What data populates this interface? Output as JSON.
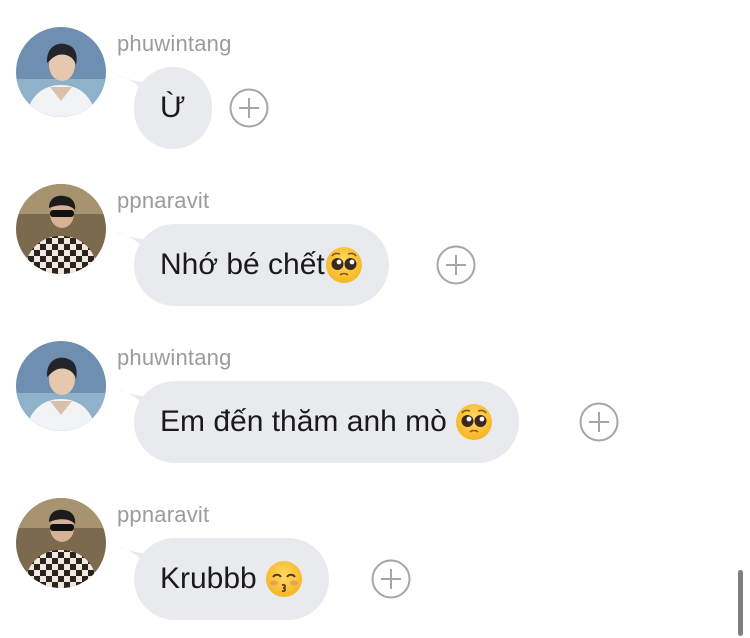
{
  "messages": [
    {
      "username": "phuwintang",
      "text": "Ừ",
      "avatar": "person-white-shirt-avatar"
    },
    {
      "username": "ppnaravit",
      "text": "Nhớ bé chết",
      "emoji": "pleading-face-emoji",
      "avatar": "person-checkered-shirt-avatar"
    },
    {
      "username": "phuwintang",
      "text": "Em đến thăm anh mò ",
      "emoji": "pleading-face-emoji",
      "avatar": "person-white-shirt-avatar"
    },
    {
      "username": "ppnaravit",
      "text": "Krubbb ",
      "emoji": "kissing-face-emoji",
      "avatar": "person-checkered-shirt-avatar"
    }
  ],
  "colors": {
    "bubble": "#e8eaed",
    "username": "#9b9b9e",
    "text": "#1a1a1a",
    "plus_icon": "#a6a6aa"
  },
  "icons": {
    "add_reaction": "plus-circle-icon"
  }
}
